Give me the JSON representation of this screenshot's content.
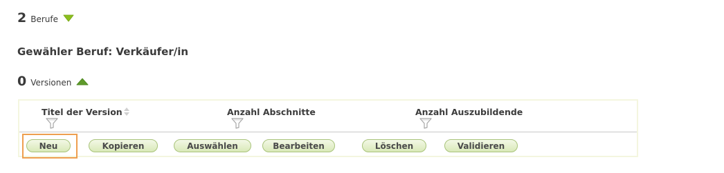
{
  "berufe": {
    "count": "2",
    "label": "Berufe"
  },
  "selected": {
    "title": "Gewähler Beruf: Verkäufer/in"
  },
  "versionen": {
    "count": "0",
    "label": "Versionen"
  },
  "table": {
    "columns": [
      "Titel der Version",
      "Anzahl Abschnitte",
      "Anzahl Auszubildende"
    ]
  },
  "buttons": {
    "neu": "Neu",
    "kopieren": "Kopieren",
    "auswaehlen": "Auswählen",
    "bearbeiten": "Bearbeiten",
    "loeschen": "Löschen",
    "validieren": "Validieren"
  },
  "colors": {
    "toggle_down": "#8cbf1e",
    "toggle_up": "#5f9a2b",
    "button_border": "#a8c37a",
    "focus_outline": "#ee9e4f",
    "panel_border": "#f4f6df"
  },
  "icons": {
    "berufe_toggle": "triangle-down-icon",
    "versionen_toggle": "triangle-up-icon",
    "sort": "sort-arrows-icon",
    "filter": "filter-funnel-icon"
  }
}
